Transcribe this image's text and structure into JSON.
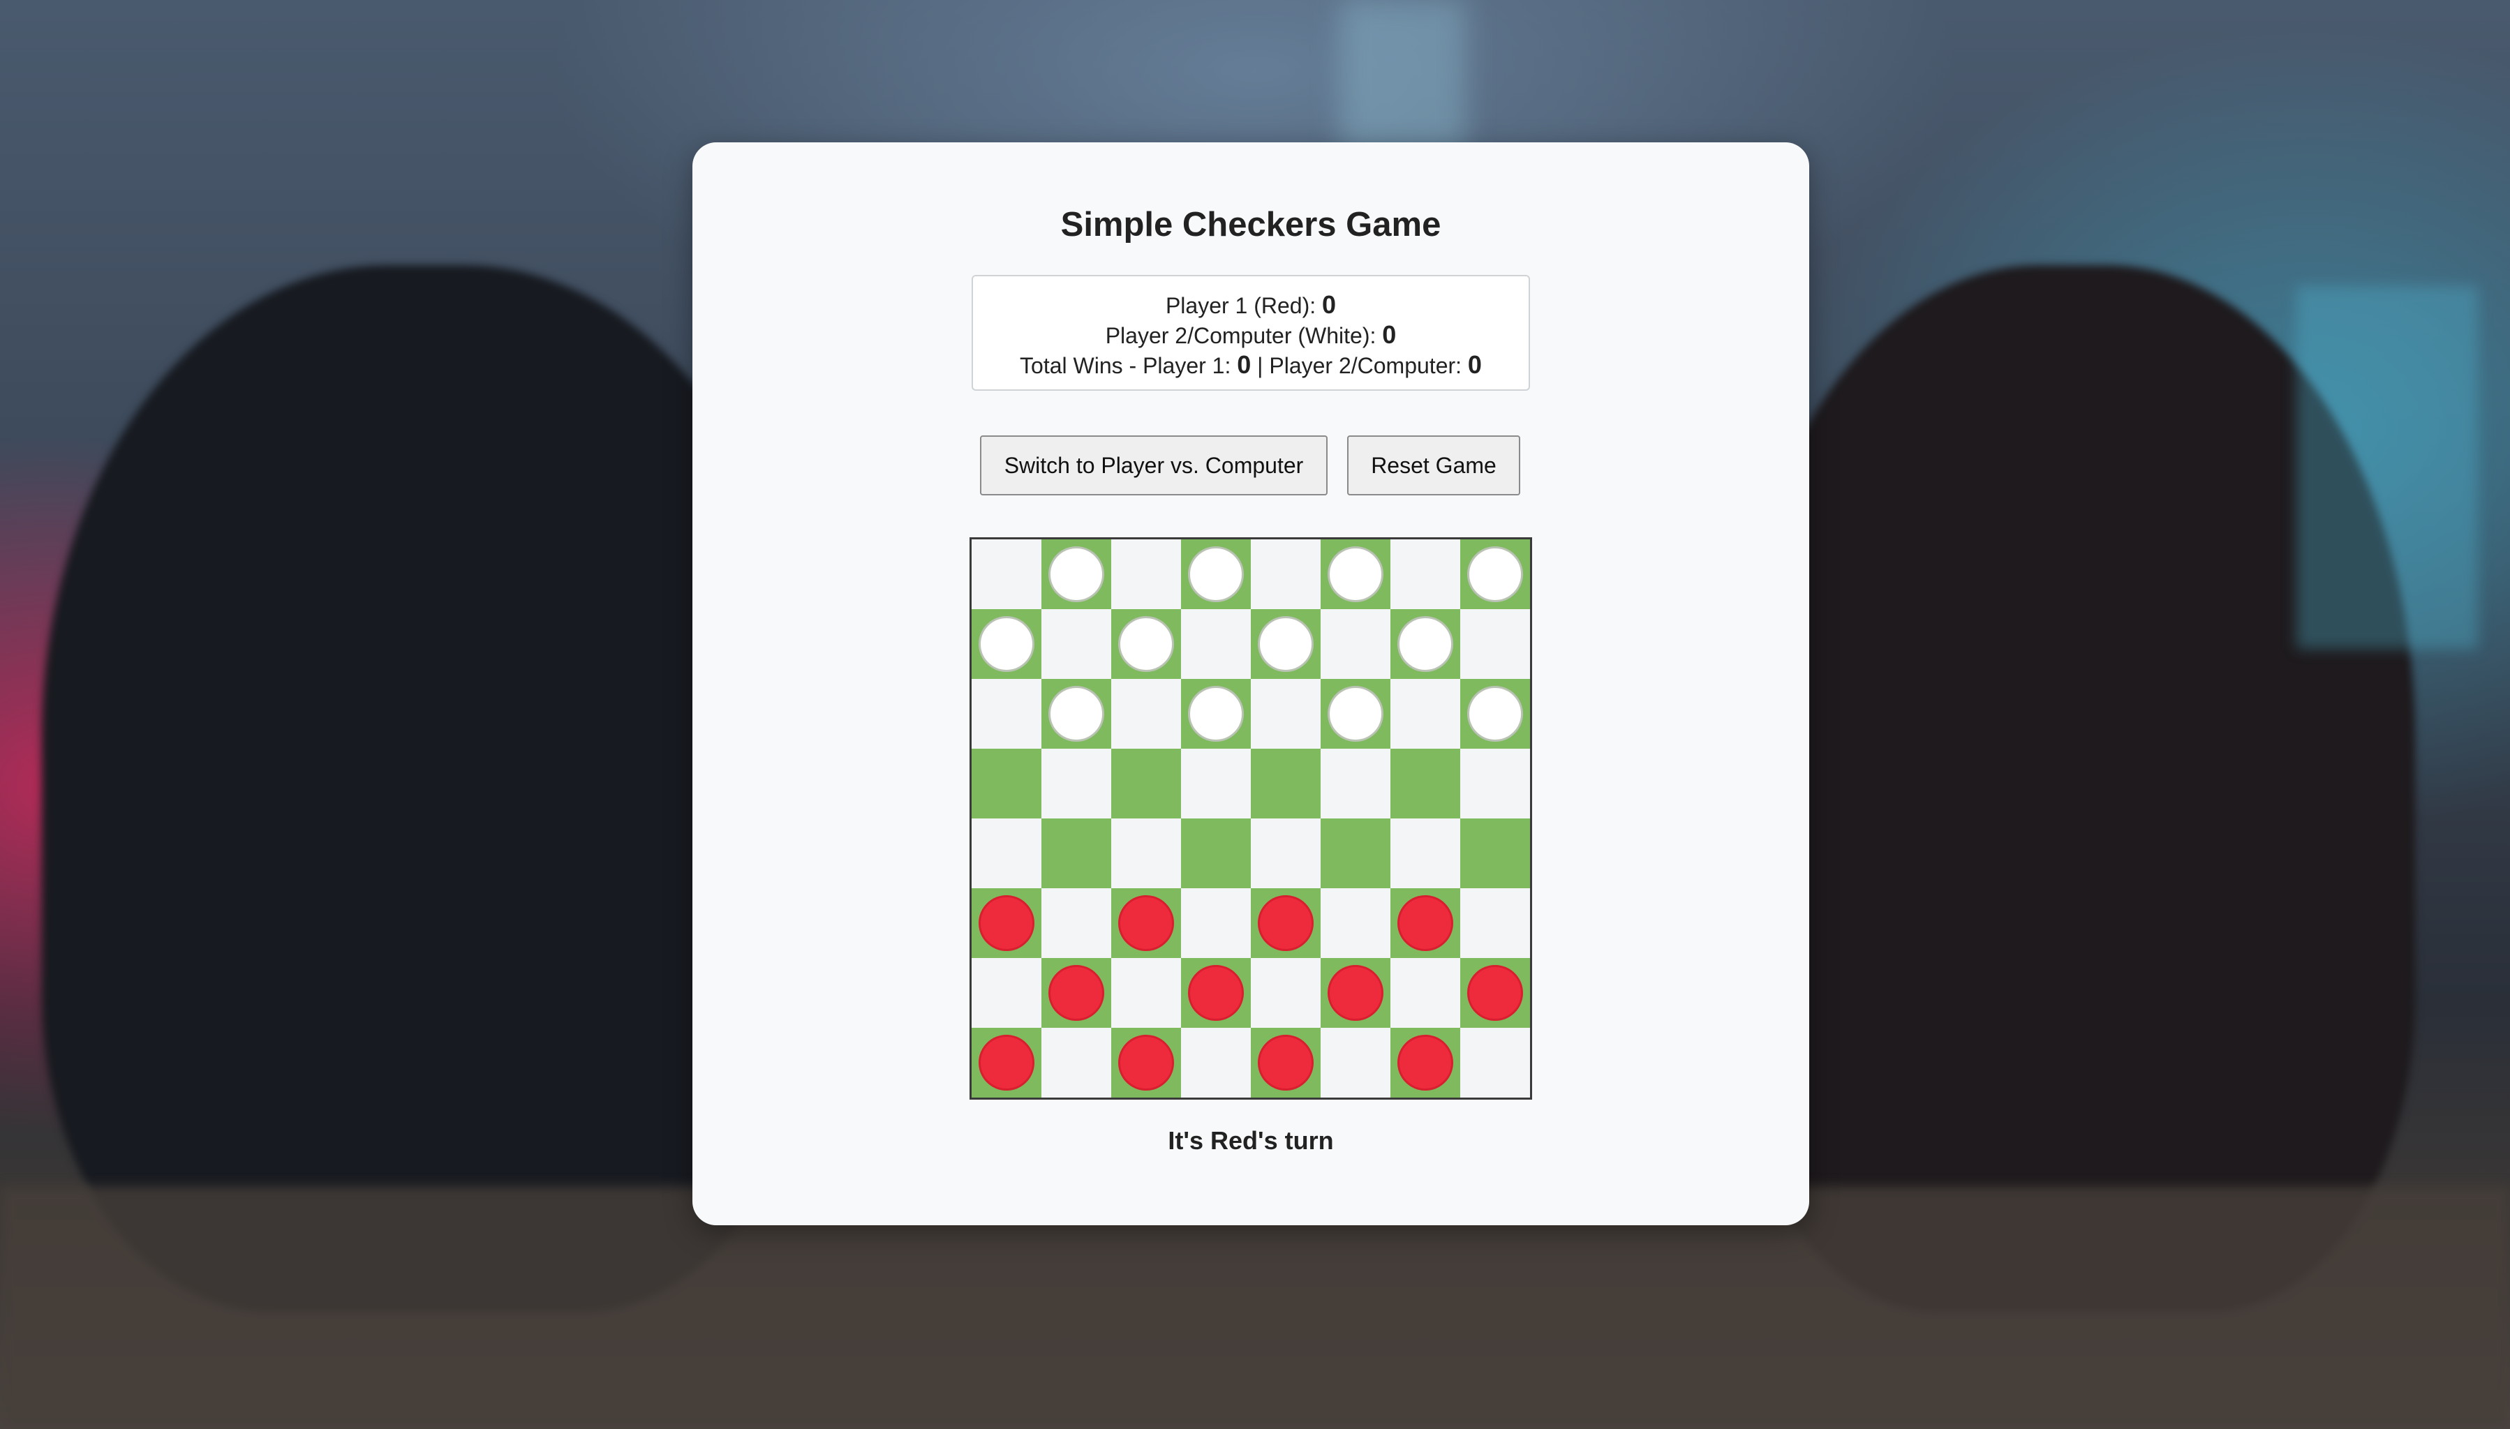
{
  "title": "Simple Checkers Game",
  "scores": {
    "p1_label": "Player 1 (Red): ",
    "p1_score": "0",
    "p2_label": "Player 2/Computer (White): ",
    "p2_score": "0",
    "wins_label": "Total Wins - Player 1: ",
    "wins_p1": "0",
    "wins_sep": " | Player 2/Computer: ",
    "wins_p2": "0"
  },
  "buttons": {
    "mode": "Switch to Player vs. Computer",
    "reset": "Reset Game"
  },
  "board": {
    "rows": [
      ".w.w.w.w",
      "w.w.w.w.",
      ".w.w.w.w",
      "........",
      "........",
      "r.r.r.r.",
      ".r.r.r.r",
      "r.r.r.r."
    ],
    "colors": {
      "light_square": "#f4f5f6",
      "dark_square": "#7fba5e",
      "red_piece": "#ee2b3c",
      "white_piece": "#ffffff"
    }
  },
  "status": "It's Red's turn"
}
